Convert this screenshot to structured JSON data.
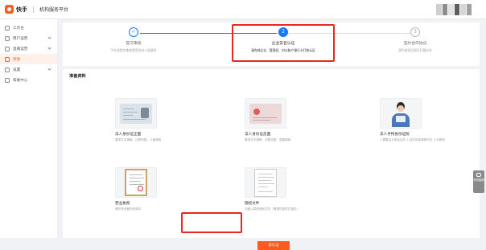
{
  "header": {
    "brand": "快手",
    "platform": "机构服务平台",
    "colors": {
      "accent": "#ff5a1f",
      "highlight": "#e8281e",
      "primary": "#1677ff"
    }
  },
  "sidebar": {
    "items": [
      {
        "label": "工作台",
        "icon": "home-icon",
        "has_children": false,
        "active": false
      },
      {
        "label": "用户运营",
        "icon": "users-icon",
        "has_children": true,
        "active": false
      },
      {
        "label": "直播运营",
        "icon": "live-icon",
        "has_children": true,
        "active": false
      },
      {
        "label": "资质",
        "icon": "certificate-icon",
        "has_children": false,
        "active": true
      },
      {
        "label": "设置",
        "icon": "gear-icon",
        "has_children": true,
        "active": false
      },
      {
        "label": "帮助中心",
        "icon": "help-icon",
        "has_children": false,
        "active": false
      }
    ]
  },
  "steps": [
    {
      "number": "✓",
      "title": "提交审核",
      "desc": "平台会提交审核是否符合入驻要求",
      "status": "done"
    },
    {
      "number": "2",
      "title": "企业实名认证",
      "desc": "请完成企业、管理员、对公账户银行卡打款认证",
      "status": "current"
    },
    {
      "number": "3",
      "title": "签约合作协议",
      "desc": "签约成功后即可开展业务",
      "status": "pending"
    }
  ],
  "materials": {
    "title": "准备资料",
    "items": [
      {
        "title": "法人身份证正面",
        "desc": "要求文字清晰、边框完整，人像清晰",
        "thumb": "idcard-back"
      },
      {
        "title": "法人身份证反面",
        "desc": "要求文字清晰、边框完整，国徽清晰",
        "thumb": "idcard-front"
      },
      {
        "title": "法人手持身份证照",
        "desc": "1.需露出五官及证件 2.证件信息清晰可见 3.无遮挡",
        "thumb": "person-holding-id"
      },
      {
        "title": "营业执照",
        "desc": "需在有效期内的原件",
        "thumb": "business-license"
      },
      {
        "title": "授权文件",
        "desc": "加盖公章的授权文件（需提供原件扫描件）",
        "thumb": "authorization-doc"
      }
    ],
    "cta_label": "去认证"
  },
  "float": {
    "label": "在线客服"
  }
}
